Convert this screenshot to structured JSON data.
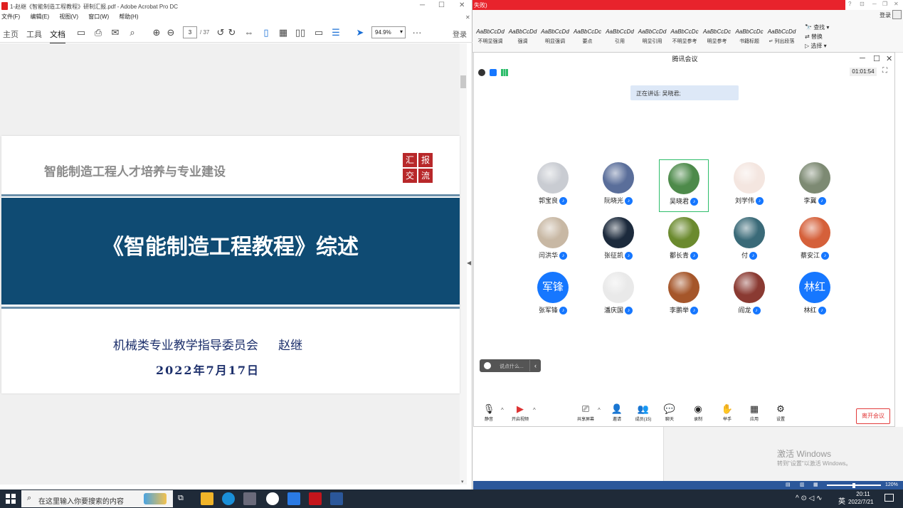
{
  "acrobat": {
    "title": "1-赵继《智能制造工程教程》研制汇报.pdf - Adobe Acrobat Pro DC",
    "menu": [
      "文件(F)",
      "编辑(E)",
      "视图(V)",
      "窗口(W)",
      "帮助(H)"
    ],
    "nav_tabs": [
      "主页",
      "工具",
      "文档"
    ],
    "active_tab": "文档",
    "page_current": "3",
    "page_total": "/ 37",
    "zoom": "94.9%",
    "login": "登录"
  },
  "slide": {
    "heading": "智能制造工程人才培养与专业建设",
    "logo_chars": [
      "汇",
      "报",
      "交",
      "流"
    ],
    "title": "《智能制造工程教程》综述",
    "author": "机械类专业教学指导委员会      赵继",
    "date": "2022年7月17日"
  },
  "word": {
    "title_fragment": "失败)",
    "login": "登录",
    "styles": [
      {
        "sample": "AaBbCcDd",
        "name": "不明显强调"
      },
      {
        "sample": "AaBbCcDd",
        "name": "强调"
      },
      {
        "sample": "AaBbCcDd",
        "name": "明显强调"
      },
      {
        "sample": "AaBbCcDc",
        "name": "要点"
      },
      {
        "sample": "AaBbCcDd",
        "name": "引用"
      },
      {
        "sample": "AaBbCcDd",
        "name": "明显引用"
      },
      {
        "sample": "AaBbCcDc",
        "name": "不明显参考"
      },
      {
        "sample": "AaBbCcDc",
        "name": "明显参考"
      },
      {
        "sample": "AaBbCcDc",
        "name": "书籍标题"
      },
      {
        "sample": "AaBbCcDd",
        "name": "↵ 列出段落"
      }
    ],
    "edit_commands": [
      "查找 ▾",
      "替换",
      "选择 ▾"
    ],
    "activate_title": "激活 Windows",
    "activate_sub": "转到\"设置\"以激活 Windows。",
    "zoom": "120%"
  },
  "meeting": {
    "title": "腾讯会议",
    "timer": "01:01:54",
    "speaking": "正在讲话: 吴晓君;",
    "participants": [
      {
        "name": "郭宝良",
        "color": "#c9ccd2"
      },
      {
        "name": "阮晓光",
        "color": "#5a6e9a"
      },
      {
        "name": "吴晓君",
        "color": "#4d8a4a"
      },
      {
        "name": "刘学伟",
        "color": "#f4e6e0"
      },
      {
        "name": "李冀",
        "color": "#7d8a73"
      },
      {
        "name": "闫洪华",
        "color": "#c8b8a4"
      },
      {
        "name": "张征凯",
        "color": "#1c2a3c"
      },
      {
        "name": "鄱长青",
        "color": "#6b8a2e"
      },
      {
        "name": "付",
        "color": "#3a6a78"
      },
      {
        "name": "蔡安江",
        "color": "#d5603a"
      },
      {
        "name": "张军锋",
        "avatar_text": "军锋"
      },
      {
        "name": "潘庆国",
        "color": "#e9e9e9"
      },
      {
        "name": "李鹏举",
        "color": "#a5562a"
      },
      {
        "name": "阎龙",
        "color": "#8a3a32"
      },
      {
        "name": "林红",
        "avatar_text": "林红"
      }
    ],
    "chat_placeholder": "说点什么...",
    "toolbar": {
      "mute": "静音",
      "video": "开启视频",
      "share": "共享屏幕",
      "invite": "邀请",
      "members": "成员(15)",
      "chat": "聊天",
      "record": "录制",
      "raise_hand": "举手",
      "apps": "应用",
      "settings": "设置"
    },
    "leave": "离开会议"
  },
  "taskbar": {
    "search_placeholder": "在这里输入你要搜索的内容",
    "ime": "英",
    "time": "20:11",
    "date": "2022/7/21"
  }
}
